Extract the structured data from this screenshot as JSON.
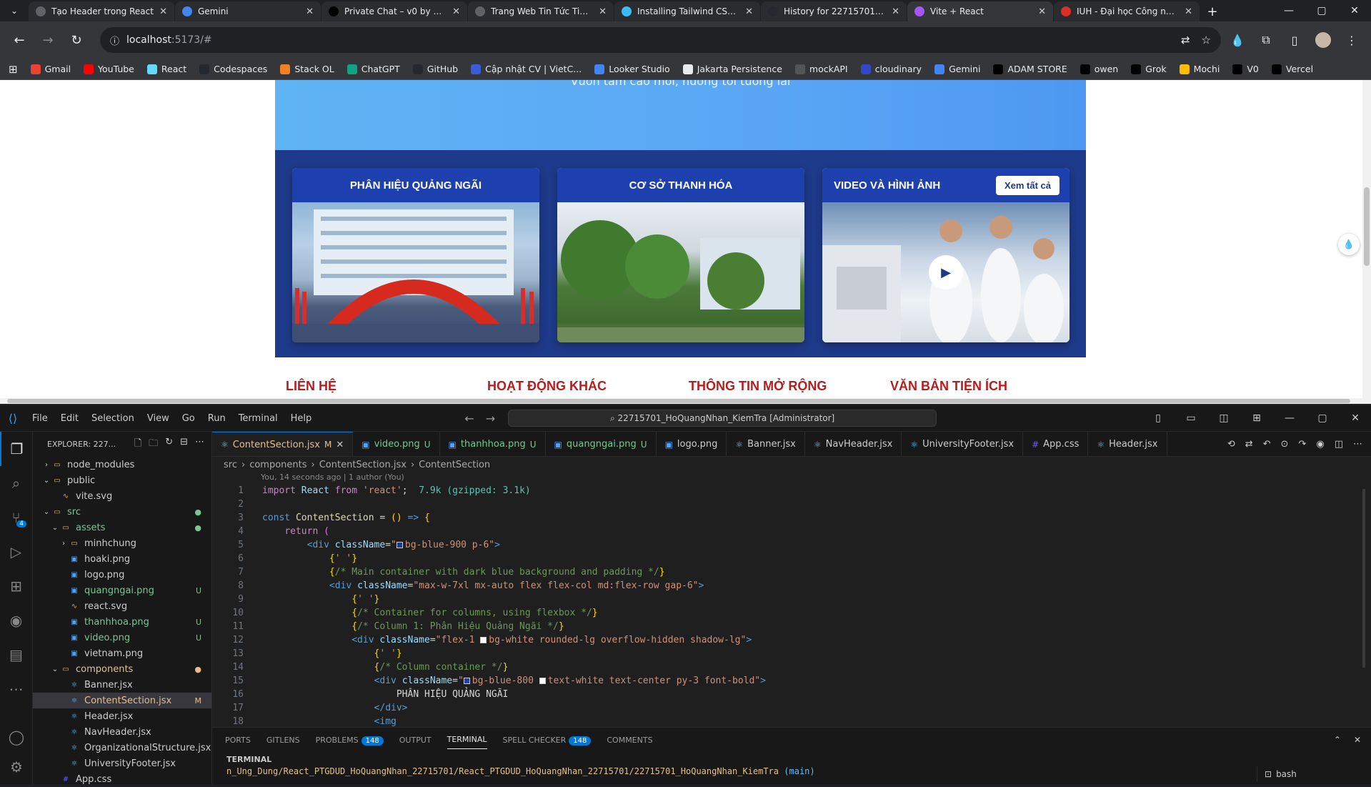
{
  "browser": {
    "tabs": [
      {
        "title": "Tạo Header trong React",
        "color": "#5f6368"
      },
      {
        "title": "Gemini",
        "color": "#4285f4"
      },
      {
        "title": "Private Chat – v0 by Vercel",
        "color": "#000000"
      },
      {
        "title": "Trang Web Tin Tức Tiếng",
        "color": "#5f6368"
      },
      {
        "title": "Installing Tailwind CSS with",
        "color": "#38bdf8"
      },
      {
        "title": "History for 22715701_Ho",
        "color": "#24292f"
      },
      {
        "title": "Vite + React",
        "color": "#a855f7",
        "active": true
      },
      {
        "title": "IUH - Đại học Công nghiệp",
        "color": "#d93025"
      }
    ],
    "url_host": "localhost",
    "url_rest": ":5173/#",
    "bookmarks": [
      {
        "label": "Gmail",
        "color": "#ea4335"
      },
      {
        "label": "YouTube",
        "color": "#ff0000"
      },
      {
        "label": "React",
        "color": "#61dafb"
      },
      {
        "label": "Codespaces",
        "color": "#24292f"
      },
      {
        "label": "Stack OL",
        "color": "#f48024"
      },
      {
        "label": "ChatGPT",
        "color": "#10a37f"
      },
      {
        "label": "GitHub",
        "color": "#24292f"
      },
      {
        "label": "Cập nhật CV | VietC...",
        "color": "#3b5bdb"
      },
      {
        "label": "Looker Studio",
        "color": "#4285f4"
      },
      {
        "label": "Jakarta Persistence",
        "color": "#e8eaed"
      },
      {
        "label": "mockAPI",
        "color": "#555555"
      },
      {
        "label": "cloudinary",
        "color": "#3448c5"
      },
      {
        "label": "Gemini",
        "color": "#4285f4"
      },
      {
        "label": "ADAM STORE",
        "color": "#000000"
      },
      {
        "label": "owen",
        "color": "#000000"
      },
      {
        "label": "Grok",
        "color": "#000000"
      },
      {
        "label": "Mochi",
        "color": "#fbbc04"
      },
      {
        "label": "V0",
        "color": "#000000"
      },
      {
        "label": "Vercel",
        "color": "#000000"
      }
    ]
  },
  "page": {
    "banner_subtitle": "Vươn tầm cao mới, hướng tới tương lai",
    "columns": [
      {
        "title": "PHÂN HIỆU QUẢNG NGÃI"
      },
      {
        "title": "CƠ SỞ THANH HÓA"
      },
      {
        "title": "VIDEO VÀ HÌNH ẢNH",
        "action": "Xem tất cả"
      }
    ],
    "footer_links": [
      "LIÊN HỆ",
      "HOẠT ĐỘNG KHÁC",
      "THÔNG TIN MỞ RỘNG",
      "VĂN BẢN TIỆN ÍCH"
    ]
  },
  "vscode": {
    "menu": [
      "File",
      "Edit",
      "Selection",
      "View",
      "Go",
      "Run",
      "Terminal",
      "Help"
    ],
    "search": "22715701_HoQuangNhan_KiemTra [Administrator]",
    "explorer_title": "EXPLORER: 227...",
    "tree": [
      {
        "label": "node_modules",
        "indent": 1,
        "type": "folder",
        "collapsed": true,
        "cls": ""
      },
      {
        "label": "public",
        "indent": 1,
        "type": "folder",
        "collapsed": false,
        "cls": ""
      },
      {
        "label": "vite.svg",
        "indent": 2,
        "type": "svg",
        "cls": ""
      },
      {
        "label": "src",
        "indent": 1,
        "type": "folder",
        "collapsed": false,
        "cls": "green",
        "status": "●"
      },
      {
        "label": "assets",
        "indent": 2,
        "type": "folder",
        "collapsed": false,
        "cls": "green",
        "status": "●"
      },
      {
        "label": "minhchung",
        "indent": 3,
        "type": "folder",
        "collapsed": true,
        "cls": ""
      },
      {
        "label": "hoaki.png",
        "indent": 3,
        "type": "img",
        "cls": ""
      },
      {
        "label": "logo.png",
        "indent": 3,
        "type": "img",
        "cls": ""
      },
      {
        "label": "quangngai.png",
        "indent": 3,
        "type": "img",
        "cls": "green",
        "status": "U"
      },
      {
        "label": "react.svg",
        "indent": 3,
        "type": "svg",
        "cls": ""
      },
      {
        "label": "thanhhoa.png",
        "indent": 3,
        "type": "img",
        "cls": "green",
        "status": "U"
      },
      {
        "label": "video.png",
        "indent": 3,
        "type": "img",
        "cls": "green",
        "status": "U"
      },
      {
        "label": "vietnam.png",
        "indent": 3,
        "type": "img",
        "cls": ""
      },
      {
        "label": "components",
        "indent": 2,
        "type": "folder",
        "collapsed": false,
        "cls": "orange",
        "status": "●"
      },
      {
        "label": "Banner.jsx",
        "indent": 3,
        "type": "react",
        "cls": ""
      },
      {
        "label": "ContentSection.jsx",
        "indent": 3,
        "type": "react",
        "cls": "orange",
        "status": "M",
        "selected": true
      },
      {
        "label": "Header.jsx",
        "indent": 3,
        "type": "react",
        "cls": ""
      },
      {
        "label": "NavHeader.jsx",
        "indent": 3,
        "type": "react",
        "cls": ""
      },
      {
        "label": "OrganizationalStructure.jsx",
        "indent": 3,
        "type": "react",
        "cls": ""
      },
      {
        "label": "UniversityFooter.jsx",
        "indent": 3,
        "type": "react",
        "cls": ""
      },
      {
        "label": "App.css",
        "indent": 2,
        "type": "css",
        "cls": ""
      }
    ],
    "editor_tabs": [
      {
        "label": "ContentSection.jsx",
        "mark": "M",
        "type": "react",
        "active": true
      },
      {
        "label": "video.png",
        "mark": "U",
        "type": "img"
      },
      {
        "label": "thanhhoa.png",
        "mark": "U",
        "type": "img"
      },
      {
        "label": "quangngai.png",
        "mark": "U",
        "type": "img"
      },
      {
        "label": "logo.png",
        "mark": "",
        "type": "img"
      },
      {
        "label": "Banner.jsx",
        "mark": "",
        "type": "react"
      },
      {
        "label": "NavHeader.jsx",
        "mark": "",
        "type": "react"
      },
      {
        "label": "UniversityFooter.jsx",
        "mark": "",
        "type": "react"
      },
      {
        "label": "App.css",
        "mark": "",
        "type": "css"
      },
      {
        "label": "Header.jsx",
        "mark": "",
        "type": "react"
      }
    ],
    "breadcrumb": [
      "src",
      "components",
      "ContentSection.jsx",
      "ContentSection"
    ],
    "blame": "You, 14 seconds ago | 1 author (You)",
    "code_lines": [
      "1",
      "2",
      "3",
      "4",
      "5",
      "6",
      "7",
      "8",
      "9",
      "10",
      "11",
      "12",
      "13",
      "14",
      "15",
      "16",
      "17",
      "18"
    ],
    "panel_tabs": [
      {
        "label": "PORTS"
      },
      {
        "label": "GITLENS"
      },
      {
        "label": "PROBLEMS",
        "badge": "148"
      },
      {
        "label": "OUTPUT"
      },
      {
        "label": "TERMINAL",
        "active": true
      },
      {
        "label": "SPELL CHECKER",
        "badge": "148"
      },
      {
        "label": "COMMENTS"
      }
    ],
    "terminal_title": "TERMINAL",
    "terminal_path": "n_Ung_Dung/React_PTGDUD_HoQuangNhan_22715701/React_PTGDUD_HoQuangNhan_22715701/22715701_HoQuangNhan_KiemTra",
    "terminal_branch": "(main)",
    "terminal_shell": "bash"
  }
}
